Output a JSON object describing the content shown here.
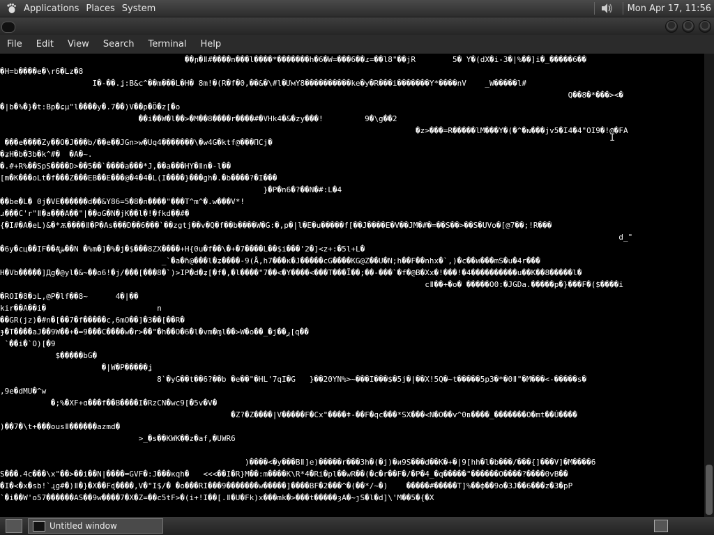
{
  "top_panel": {
    "menus": [
      "Applications",
      "Places",
      "System"
    ],
    "clock": "Mon Apr 17, 11:56",
    "icons": [
      "gnome-foot-icon",
      "volume-icon"
    ]
  },
  "window": {
    "menubar": [
      "File",
      "Edit",
      "View",
      "Search",
      "Terminal",
      "Help"
    ]
  },
  "terminal": {
    "lines": [
      "                                        ��ɲ�ǁ#����n���l����*�������h�6�W=���6��ɾ=��l8\"��jR        5� Y�(dX�i-3�|%��]i�_�����6��",
      "�H=b����e�\\r6�Lz�8",
      "                    I�-��.ʝ:B&c^��m���L�H� 8m!�(R�f�0,��&�\\#l�ƯмY8����������ke�y�R���i�������Y*����nV    _W�����l#",
      "                                                                                                                           Q��8�*���><�",
      "�|b�%�}�t:Bр�ɕµ\"l����y�.7��)V��p�Ö�z[�o",
      "                              ��i��W�l��>�M��8����r����#�VHk4�&�zy���!         9�\\g��2",
      "                                                                                          �z>���=R�����lM���Y�(�^�ɴ���jv5�I4�4\"OI9�!@�FA",
      " ���e����Zy��O�J���b/��e��JGn>w�Uq4�������\\�w4G�ktf@���ПCj�",
      "�ʑH�b�3b�k^#�  �A�~.",
      "�.#+R%��SpS����D>��5��`����a���*J,��a���HY�ǁn�-l��",
      "[m�K���oLt�f���Z���EB��E���@�4�4�L(I����}���gh�.�b����?�I���",
      "                                                         }�P�n6�?��N�#:L�4",
      "��be�L� 0j�VE������d��&Y86=5�8�n����\"���T^m^�.w���V*!",
      "ɹ���C'r\"ǁ�a���A��\"|��oG�N�jK��l�!�fkd��#�",
      "{�I#�A�eL)&�*Ѫ����ǁ�P�As���D��6���`��zgtj��v�Q�f��b����W�G:�,p�|l�E�u�����f[��J����E�V��JM�#�=��S��>��S�UVo�[@7��;!R���",
      "                                                                                                                                      d_\"",
      "�6y�сц��IF��#ش��N �%m�]�%�j�$���8ZX����+H{0u�f��\\�+�7����L��$i���'2�]<z+:�5l+L�",
      "                                   _`�a�ɦ@���l�ʑ����-9(Å,h7���к�J�����сG����KG@Z��U�N;h��F��nhx�`,)�c��и���mS�u�4r���",
      "H�Vb�����]Дg�@yl�&~��o6!�j/���[���8�`)>IP�d�ʑ[�f�,�l����\"7��<�Y����<���T���Ĩ��;��-���`�f�@B�Xx�!���!�4����������u��K��8�����l�",
      "                                                                                            cǁ��+�o� �����O0:�JGDa.�����p�}���F�($����i",
      "�ROI�8�ɔL,@P�lf��8~      4�|��",
      "kir��A��i�                        n",
      "��GR(jz)�#n�[��7�f�����c,6mO��]�3��[��R�",
      "ɟ�T����aJ��9W��+�=9���C����w�r>��\"�h��O�6�l�vm�ɱl��>W�o��_�j��ږ[q��",
      " `��i�`O)[�9",
      "            $�����bG�",
      "                      �|W�P�����ʝ",
      "                                  8`�yG��t��6?��b �e��\"�HL'7qI�G   }��20YN%>~���I���$�5j�|��X!5Q�~t�����5p3�*�0ǁ\"�M���<-�����s�",
      ",9e�dMU�^w",
      "           �;%�XF+ɑ���f��B����I�RzCN�wc9[�5v�V�",
      "                                                  �Z?�Z����|V�����F�Cx\"����ǂ-��F�qc���*SX���<N�O��v^0в����_�������O�mt��Ú����",
      ")��7�\\t+���ousǁ������azmd�",
      "                              >_�s��KWK��z�af,�UWR6",
      "",
      "                                                     )����<�y���Bǁ]e)�����r���3h�(�j)�и9S���d��K�+�|9[hh�l�b���/���{]���V]�M����6",
      "S���.4c���\\x\"��>��i��N|����=GVF�:J���кqh�   <<<��I�R}M��:m����K\\R*4�Ri�pl��wR��(�c�r��F�/�P�4_�q�����\"������O����?����0vB��",
      "�I�<�x�sb!`ɻg#�)ǁ�}�X��Fɖ����,V�\"I$/� �o���RI���9�������w�����]����BF�2���^�(��*/~�)    �����#�����T]%��ф��9o�3J��6���z�3�pP",
      "`�i��W'o57������AS��9w����7�X�Z=��c5tF>�(i+!I��[.ǁ�U�Fk)x���mk�>���t�����ȝA�~ȷS�l�d]\\'M��5�{�X"
    ]
  },
  "bottom_panel": {
    "task_label": "Untitled window"
  }
}
